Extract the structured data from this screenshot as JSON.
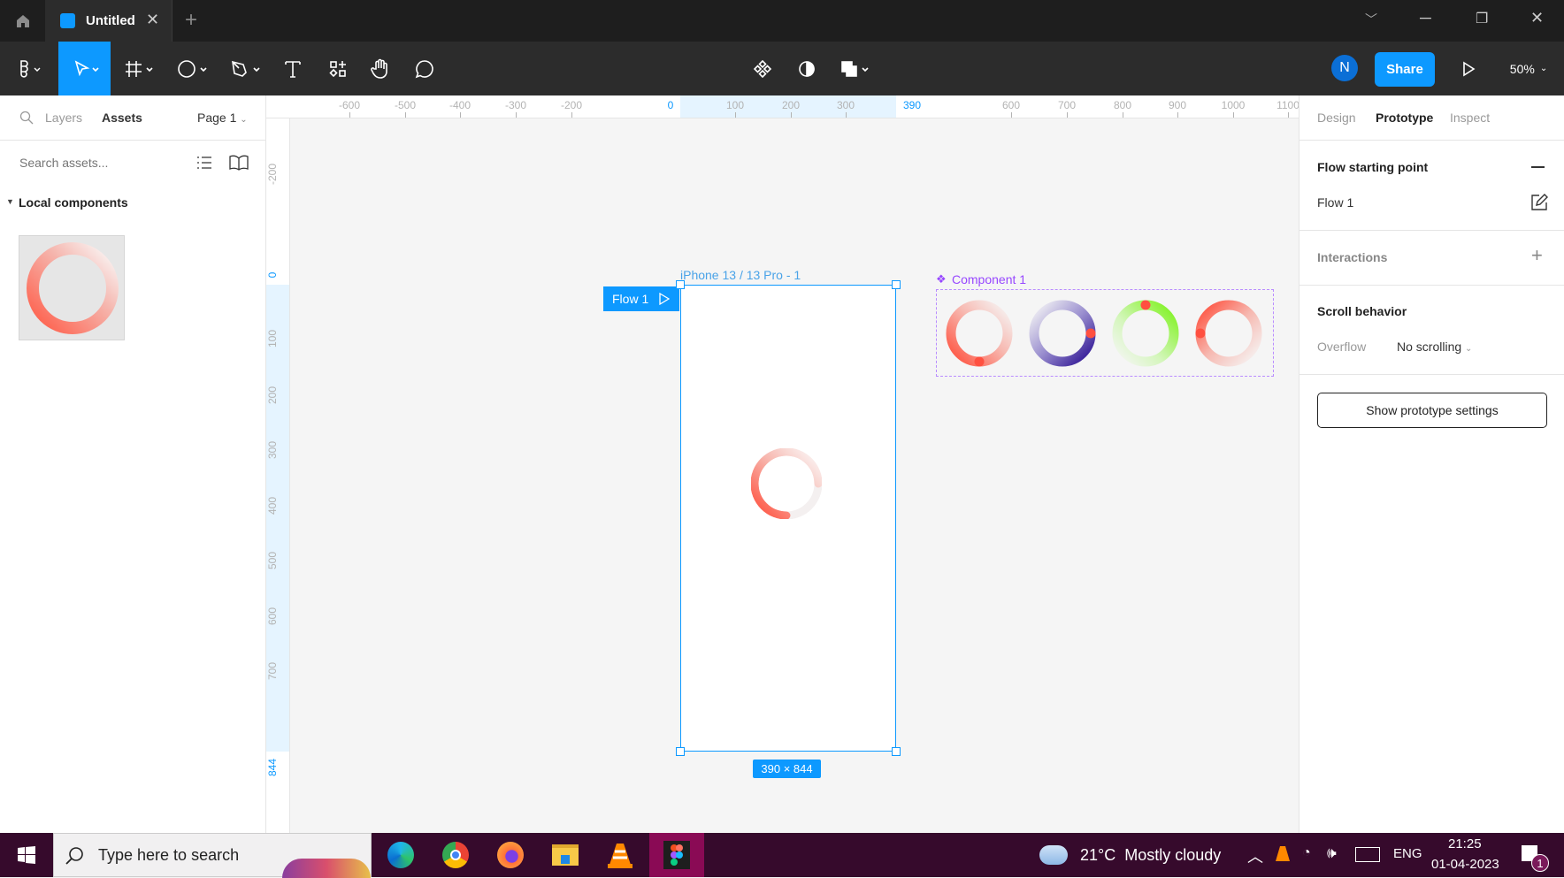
{
  "titlebar": {
    "tab_title": "Untitled",
    "home_icon": "home-icon",
    "close_icon": "close-icon",
    "new_tab_icon": "plus-icon"
  },
  "toolbar": {
    "tools": [
      "figma-menu",
      "move",
      "frame",
      "ellipse",
      "pen",
      "text",
      "resources",
      "hand",
      "comment"
    ],
    "center": [
      "component-icon",
      "contrast-icon",
      "boolean-icon"
    ],
    "avatar": "N",
    "share": "Share",
    "zoom": "50%",
    "accent": "#0d99ff"
  },
  "left": {
    "tabs": {
      "layers": "Layers",
      "assets": "Assets"
    },
    "page": "Page 1",
    "search_placeholder": "Search assets...",
    "section": "Local components"
  },
  "rulers": {
    "h": [
      "-600",
      "-500",
      "-400",
      "-300",
      "-200",
      "0",
      "100",
      "200",
      "300",
      "390",
      "600",
      "700",
      "800",
      "900",
      "1000",
      "1100"
    ],
    "v": [
      "-200",
      "0",
      "100",
      "200",
      "300",
      "400",
      "500",
      "600",
      "700",
      "844"
    ]
  },
  "canvas": {
    "frame_name": "iPhone 13 / 13 Pro - 1",
    "flow_label": "Flow 1",
    "size_label": "390 × 844",
    "component_name": "Component 1",
    "component_color": "#9747ff"
  },
  "right": {
    "tabs": [
      "Design",
      "Prototype",
      "Inspect"
    ],
    "flow_heading": "Flow starting point",
    "flow_name": "Flow 1",
    "interactions": "Interactions",
    "scroll_heading": "Scroll behavior",
    "overflow_label": "Overflow",
    "overflow_value": "No scrolling",
    "settings_button": "Show prototype settings",
    "help": "?"
  },
  "taskbar": {
    "search_placeholder": "Type here to search",
    "weather": "21°C  Mostly cloudy",
    "lang": "ENG",
    "time": "21:25",
    "date": "01-04-2023",
    "notifications": "1"
  }
}
